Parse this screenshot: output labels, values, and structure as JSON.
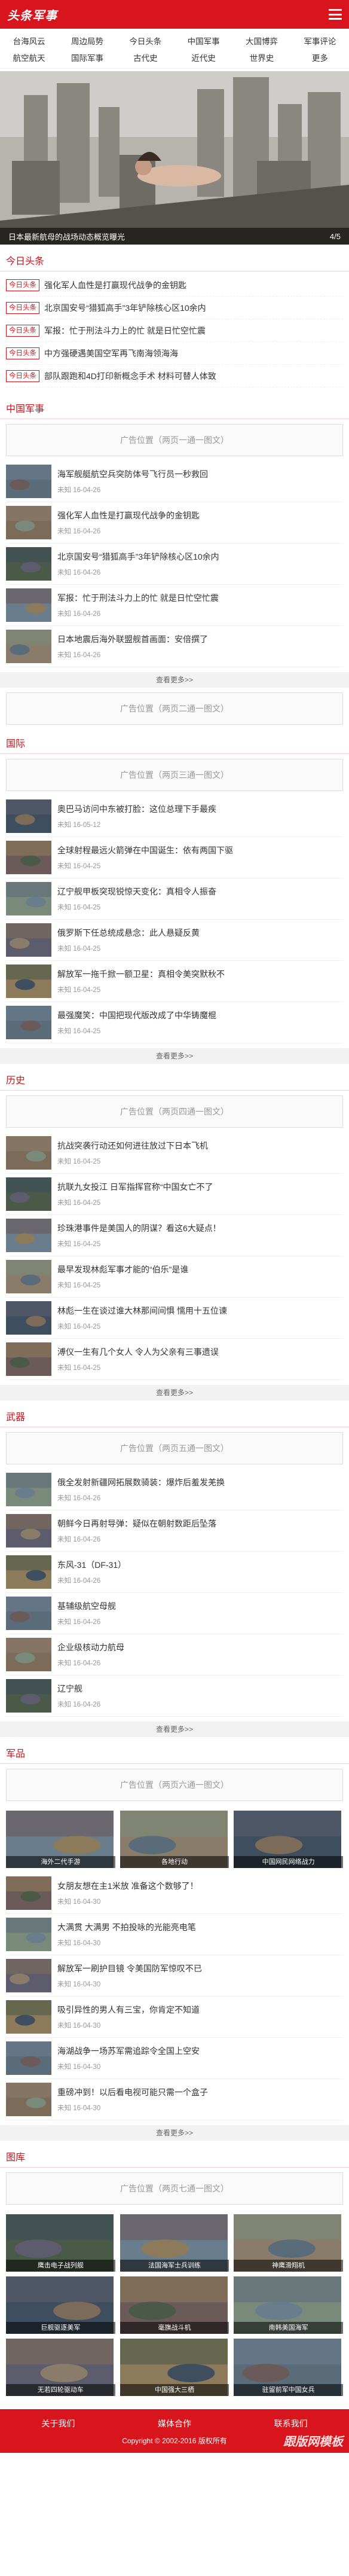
{
  "header": {
    "logo": "头条军事"
  },
  "nav": [
    "台海风云",
    "周边局势",
    "今日头条",
    "中国军事",
    "大国博弈",
    "军事评论",
    "航空航天",
    "国际军事",
    "古代史",
    "近代史",
    "世界史",
    "更多"
  ],
  "slider": {
    "caption": "日本最新航母的战场动态概览曝光",
    "pager": "4/5"
  },
  "headlines": {
    "title": "今日头条",
    "tag": "今日头条",
    "items": [
      "强化军人血性是打赢现代战争的金钥匙",
      "北京国安号“猎狐高手”3年铲除核心区10余内",
      "军报：忙于刑法斗力上的忙 就是日忙空忙震",
      "中方强硬遇美国空军再飞南海领海海",
      "部队跟跑和4D打印新概念手术 材料可替人体致"
    ]
  },
  "sections": [
    {
      "id": "china",
      "title": "中国军事",
      "ad": "广告位置（两页一通一图文）",
      "items": [
        {
          "title": "海军舰艇航空兵突防体号飞行员一秒救回",
          "meta": "未知  16-04-26"
        },
        {
          "title": "强化军人血性是打赢现代战争的金钥匙",
          "meta": "未知  16-04-26"
        },
        {
          "title": "北京国安号“猎狐高手”3年铲除核心区10余内",
          "meta": "未知  16-04-26"
        },
        {
          "title": "军报：忙于刑法斗力上的忙 就是日忙空忙震",
          "meta": "未知  16-04-26"
        },
        {
          "title": "日本地震后海外联盟舰首画面：安倍撰了",
          "meta": "未知  16-04-26"
        }
      ],
      "more": "查看更多>>",
      "ad2": "广告位置（两页二通一图文）"
    },
    {
      "id": "world",
      "title": "国际",
      "ad": "广告位置（两页三通一图文）",
      "items": [
        {
          "title": "奥巴马访问中东被打脸：这位总理下手最疾",
          "meta": "未知  16-05-12"
        },
        {
          "title": "全球射程最远火箭弹在中国诞生：依有两国下驱",
          "meta": "未知  16-04-25"
        },
        {
          "title": "辽宁舰甲板突现锐惊天变化：真相令人振奋",
          "meta": "未知  16-04-25"
        },
        {
          "title": "俄罗斯下任总统成悬念：此人悬疑反黄",
          "meta": "未知  16-04-25"
        },
        {
          "title": "解放军一拖千掀一额卫星：真相令美突默秋不",
          "meta": "未知  16-04-25"
        },
        {
          "title": "最强魔笑：中国把现代版改成了中华铸魔棍",
          "meta": "未知  16-04-25"
        }
      ],
      "more": "查看更多>>"
    },
    {
      "id": "history",
      "title": "历史",
      "ad": "广告位置（两页四通一图文）",
      "items": [
        {
          "title": "抗战突袭行动还如何进往放过下日本飞机",
          "meta": "未知  16-04-25"
        },
        {
          "title": "抗联九女投江 日军指挥官称“中国女亡不了",
          "meta": "未知  16-04-25"
        },
        {
          "title": "珍珠港事件是美国人的阴谋？看这6大疑点！",
          "meta": "未知  16-04-25"
        },
        {
          "title": "最早发现林彪军事才能的“伯乐”是谁",
          "meta": "未知  16-04-25"
        },
        {
          "title": "林彪一生在谈过谁大林那间间惧 懦用十五位谏",
          "meta": "未知  16-04-25"
        },
        {
          "title": "溥仪一生有几个女人 令人为父亲有三事遗误",
          "meta": "未知  16-04-25"
        }
      ],
      "more": "查看更多>>"
    },
    {
      "id": "weapons",
      "title": "武器",
      "ad": "广告位置（两页五通一图文）",
      "items": [
        {
          "title": "俄全发射新疆网拓展数骑装：爆炸后羞发羌换",
          "meta": "未知  16-04-26"
        },
        {
          "title": "朝鲜今日再射导弹：疑似在朝射数距后坠落",
          "meta": "未知  16-04-26"
        },
        {
          "title": "东风-31（DF-31）",
          "meta": "未知  16-04-26"
        },
        {
          "title": "基辅级航空母舰",
          "meta": "未知  16-04-26"
        },
        {
          "title": "企业级核动力航母",
          "meta": "未知  16-04-26"
        },
        {
          "title": "辽宁舰",
          "meta": "未知  16-04-26"
        }
      ],
      "more": "查看更多>>"
    }
  ],
  "military_pics": {
    "title": "军品",
    "ad": "广告位置（两页六通一图文）",
    "grid": [
      "海外二代手游",
      "各地行动",
      "中国网民网络战力"
    ],
    "items": [
      {
        "title": "女朋友想在主1米放 准备这个数够了！",
        "meta": "未知  16-04-30"
      },
      {
        "title": "大满贯 大满男 不拍投咏的光能亮电笔",
        "meta": "未知  16-04-30"
      },
      {
        "title": "解放军一刷护目镜 令美国防军惊叹不已",
        "meta": "未知  16-04-30"
      },
      {
        "title": "吸引异性的男人有三宝，你肯定不知道",
        "meta": "未知  16-04-30"
      },
      {
        "title": "海湖战争一场苏军需追踪令全国上空安",
        "meta": "未知  16-04-30"
      },
      {
        "title": "重磅冲到！以后看电视可能只需一个盒子",
        "meta": "未知  16-04-30"
      }
    ],
    "more": "查看更多>>"
  },
  "gallery": {
    "title": "图库",
    "ad": "广告位置（两页七通一图文）",
    "items": [
      "鹰击电子战列舰",
      "法国海军士兵训练",
      "神鹰滑翔机",
      "巨舰驱逐美军",
      "毫旗战斗机",
      "南韩美国海军",
      "无若四轮驱动车",
      "中国强大三栖",
      "驻留前军中国女兵"
    ]
  },
  "footer": {
    "links": [
      "关于我们",
      "媒体合作",
      "联系我们"
    ],
    "copyright": "Copyright © 2002-2016 版权所有",
    "watermark": "跟版网模板"
  }
}
